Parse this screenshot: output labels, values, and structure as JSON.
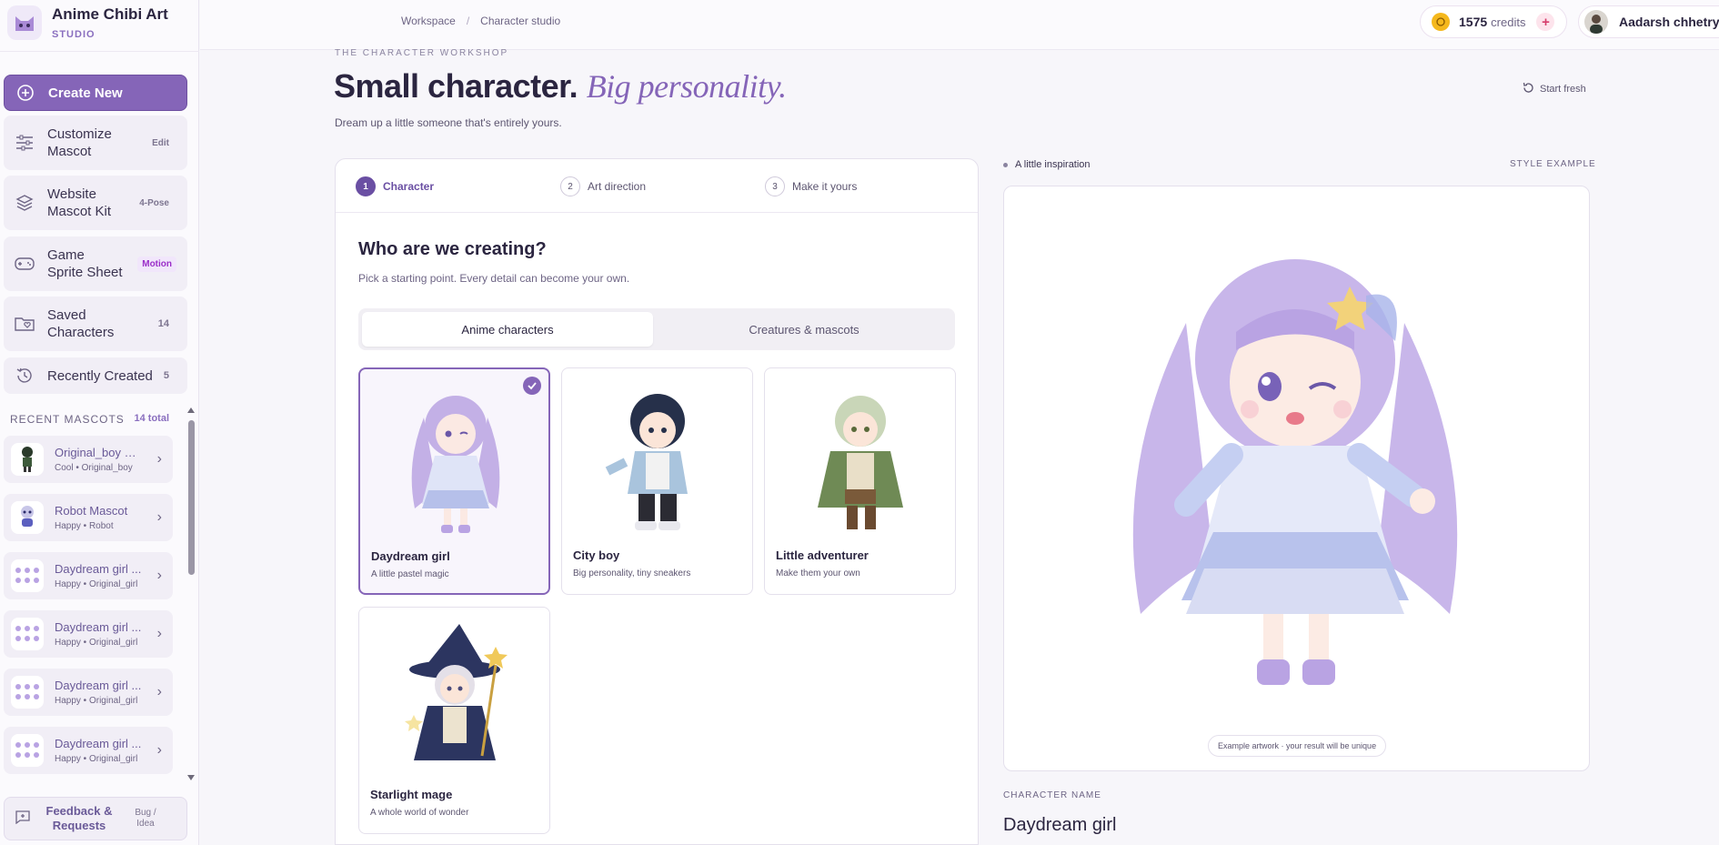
{
  "brand": {
    "name": "Anime Chibi Art",
    "sub": "STUDIO",
    "icon": "cat-face-icon"
  },
  "sidebar": {
    "items": [
      {
        "label": "Create New",
        "icon": "plus-circle-icon",
        "tag": ""
      },
      {
        "label": "Customize Mascot",
        "icon": "sliders-icon",
        "tag": "Edit"
      },
      {
        "label": "Website Mascot Kit",
        "icon": "layers-icon",
        "tag": "4-Pose"
      },
      {
        "label": "Game Sprite Sheet",
        "icon": "gamepad-icon",
        "tag": "Motion"
      },
      {
        "label": "Saved Characters",
        "icon": "folder-heart-icon",
        "tag": "14"
      },
      {
        "label": "Recently Created",
        "icon": "history-icon",
        "tag": "5"
      }
    ],
    "recent_title": "RECENT MASCOTS",
    "recent_count": "14 total",
    "mascots": [
      {
        "name": "Original_boy M...",
        "sub": "Cool  •  Original_boy"
      },
      {
        "name": "Robot Mascot",
        "sub": "Happy  •  Robot"
      },
      {
        "name": "Daydream girl ...",
        "sub": "Happy  •  Original_girl"
      },
      {
        "name": "Daydream girl ...",
        "sub": "Happy  •  Original_girl"
      },
      {
        "name": "Daydream girl ...",
        "sub": "Happy  •  Original_girl"
      },
      {
        "name": "Daydream girl ...",
        "sub": "Happy  •  Original_girl"
      }
    ],
    "feedback": {
      "label": "Feedback & Requests",
      "tag": "Bug / Idea"
    }
  },
  "topbar": {
    "crumbs": [
      "Workspace",
      "/",
      "Character studio"
    ],
    "credits": "1575",
    "credits_unit": "credits",
    "add": "+",
    "user": "Aadarsh chhetry"
  },
  "hero": {
    "eyebrow": "THE CHARACTER WORKSHOP",
    "title": "Small character.",
    "title_accent": "Big personality.",
    "subtitle": "Dream up a little someone that's entirely yours.",
    "reset": "Start fresh"
  },
  "steps": [
    {
      "n": "1",
      "label": "Character"
    },
    {
      "n": "2",
      "label": "Art direction"
    },
    {
      "n": "3",
      "label": "Make it yours"
    }
  ],
  "question": {
    "title": "Who are we creating?",
    "subtitle": "Pick a starting point. Every detail can become your own."
  },
  "tabs": [
    "Anime characters",
    "Creatures & mascots"
  ],
  "cards": [
    {
      "title": "Daydream girl",
      "sub": "A little pastel magic"
    },
    {
      "title": "City boy",
      "sub": "Big personality, tiny sneakers"
    },
    {
      "title": "Little adventurer",
      "sub": "Make them your own"
    },
    {
      "title": "Starlight mage",
      "sub": "A whole world of wonder"
    }
  ],
  "preview": {
    "label": "A little inspiration",
    "style": "STYLE EXAMPLE",
    "note": "Example artwork · your result will be unique",
    "name_label": "CHARACTER NAME",
    "name_value": "Daydream girl"
  },
  "colors": {
    "accent": "#8565b8",
    "coin": "#f5b81c",
    "motion": "#9b2fc9"
  }
}
